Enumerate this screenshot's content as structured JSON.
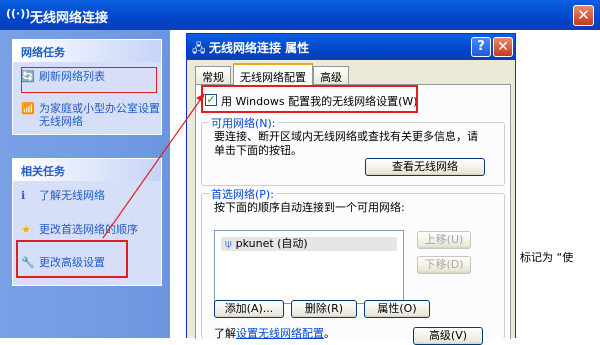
{
  "main_window": {
    "app_icon": "((·))",
    "title": "无线网络连接"
  },
  "tasks": {
    "network_tasks": {
      "title": "网络任务",
      "items": [
        {
          "label": "刷新网络列表",
          "icon": "refresh-icon"
        },
        {
          "label": "为家庭或小型办公室设置无线网络",
          "icon": "setup-wireless-icon"
        }
      ]
    },
    "related_tasks": {
      "title": "相关任务",
      "items": [
        {
          "label": "了解无线网络",
          "icon": "info-icon"
        },
        {
          "label": "更改首选网络的顺序",
          "icon": "star-icon"
        },
        {
          "label": "更改高级设置",
          "icon": "tools-icon"
        }
      ]
    }
  },
  "dialog": {
    "title": "无线网络连接 属性",
    "tabs": [
      "常规",
      "无线网络配置",
      "高级"
    ],
    "use_windows_checkbox": {
      "label": "用 Windows 配置我的无线网络设置(W)",
      "checked": true
    },
    "available": {
      "title": "可用网络(N):",
      "desc_line1": "要连接、断开区域内无线网络或查找有关更多信息，请",
      "desc_line2": "单击下面的按钮。",
      "view_button": "查看无线网络"
    },
    "preferred": {
      "title": "首选网络(P):",
      "desc": "按下面的顺序自动连接到一个可用网络:",
      "networks": [
        {
          "name": "pkunet (自动)"
        }
      ],
      "move_up": "上移(U)",
      "move_down": "下移(D)",
      "add": "添加(A)...",
      "remove": "删除(R)",
      "properties": "属性(O)"
    },
    "learn_prefix": "了解",
    "learn_link": "设置无线网络配置",
    "learn_suffix": "。",
    "advanced_button": "高级(V)"
  },
  "background_fragment": "标记为 “使",
  "colors": {
    "highlight_box": "#e0201c",
    "titlebar": "#0246c8",
    "link": "#215dc6"
  }
}
